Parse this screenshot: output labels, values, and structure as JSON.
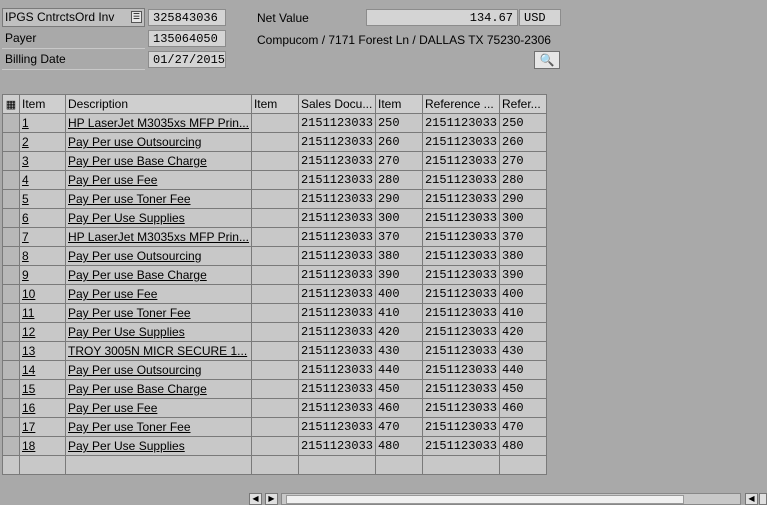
{
  "header": {
    "doc_type": "IPGS CntrctsOrd Inv",
    "doc_number": "325843036",
    "payer_label": "Payer",
    "payer_value": "135064050",
    "billing_date_label": "Billing Date",
    "billing_date_value": "01/27/2015",
    "net_value_label": "Net Value",
    "net_value_amount": "134.67",
    "currency": "USD",
    "address": "Compucom / 7171 Forest Ln / DALLAS TX 75230-2306"
  },
  "table": {
    "columns": [
      "Item",
      "Description",
      "Item",
      "Sales Docu...",
      "Item",
      "Reference ...",
      "Refer..."
    ],
    "rows": [
      {
        "item": "1",
        "description": "HP LaserJet M3035xs MFP Prin...",
        "item2": "",
        "sales_doc": "2151123033",
        "item3": "250",
        "reference": "2151123033",
        "refer": "250"
      },
      {
        "item": "2",
        "description": "Pay Per use Outsourcing",
        "item2": "",
        "sales_doc": "2151123033",
        "item3": "260",
        "reference": "2151123033",
        "refer": "260"
      },
      {
        "item": "3",
        "description": "Pay Per use Base Charge",
        "item2": "",
        "sales_doc": "2151123033",
        "item3": "270",
        "reference": "2151123033",
        "refer": "270"
      },
      {
        "item": "4",
        "description": "Pay Per use Fee",
        "item2": "",
        "sales_doc": "2151123033",
        "item3": "280",
        "reference": "2151123033",
        "refer": "280"
      },
      {
        "item": "5",
        "description": "Pay Per use Toner Fee",
        "item2": "",
        "sales_doc": "2151123033",
        "item3": "290",
        "reference": "2151123033",
        "refer": "290"
      },
      {
        "item": "6",
        "description": "Pay Per Use Supplies",
        "item2": "",
        "sales_doc": "2151123033",
        "item3": "300",
        "reference": "2151123033",
        "refer": "300"
      },
      {
        "item": "7",
        "description": "HP LaserJet M3035xs MFP Prin...",
        "item2": "",
        "sales_doc": "2151123033",
        "item3": "370",
        "reference": "2151123033",
        "refer": "370"
      },
      {
        "item": "8",
        "description": "Pay Per use Outsourcing",
        "item2": "",
        "sales_doc": "2151123033",
        "item3": "380",
        "reference": "2151123033",
        "refer": "380"
      },
      {
        "item": "9",
        "description": "Pay Per use Base Charge",
        "item2": "",
        "sales_doc": "2151123033",
        "item3": "390",
        "reference": "2151123033",
        "refer": "390"
      },
      {
        "item": "10",
        "description": "Pay Per use Fee",
        "item2": "",
        "sales_doc": "2151123033",
        "item3": "400",
        "reference": "2151123033",
        "refer": "400"
      },
      {
        "item": "11",
        "description": "Pay Per use Toner Fee",
        "item2": "",
        "sales_doc": "2151123033",
        "item3": "410",
        "reference": "2151123033",
        "refer": "410"
      },
      {
        "item": "12",
        "description": "Pay Per Use Supplies",
        "item2": "",
        "sales_doc": "2151123033",
        "item3": "420",
        "reference": "2151123033",
        "refer": "420"
      },
      {
        "item": "13",
        "description": "TROY 3005N MICR SECURE 1...",
        "item2": "",
        "sales_doc": "2151123033",
        "item3": "430",
        "reference": "2151123033",
        "refer": "430"
      },
      {
        "item": "14",
        "description": "Pay Per use Outsourcing",
        "item2": "",
        "sales_doc": "2151123033",
        "item3": "440",
        "reference": "2151123033",
        "refer": "440"
      },
      {
        "item": "15",
        "description": "Pay Per use Base Charge",
        "item2": "",
        "sales_doc": "2151123033",
        "item3": "450",
        "reference": "2151123033",
        "refer": "450"
      },
      {
        "item": "16",
        "description": "Pay Per use Fee",
        "item2": "",
        "sales_doc": "2151123033",
        "item3": "460",
        "reference": "2151123033",
        "refer": "460"
      },
      {
        "item": "17",
        "description": "Pay Per use Toner Fee",
        "item2": "",
        "sales_doc": "2151123033",
        "item3": "470",
        "reference": "2151123033",
        "refer": "470"
      },
      {
        "item": "18",
        "description": "Pay Per Use Supplies",
        "item2": "",
        "sales_doc": "2151123033",
        "item3": "480",
        "reference": "2151123033",
        "refer": "480"
      }
    ]
  },
  "icons": {
    "doc_type_dropdown": "dropdown-icon",
    "address_details": "magnifier-document-icon",
    "table_settings": "table-settings-icon",
    "scroll_left": "arrow-left-icon",
    "scroll_right": "arrow-right-icon"
  }
}
